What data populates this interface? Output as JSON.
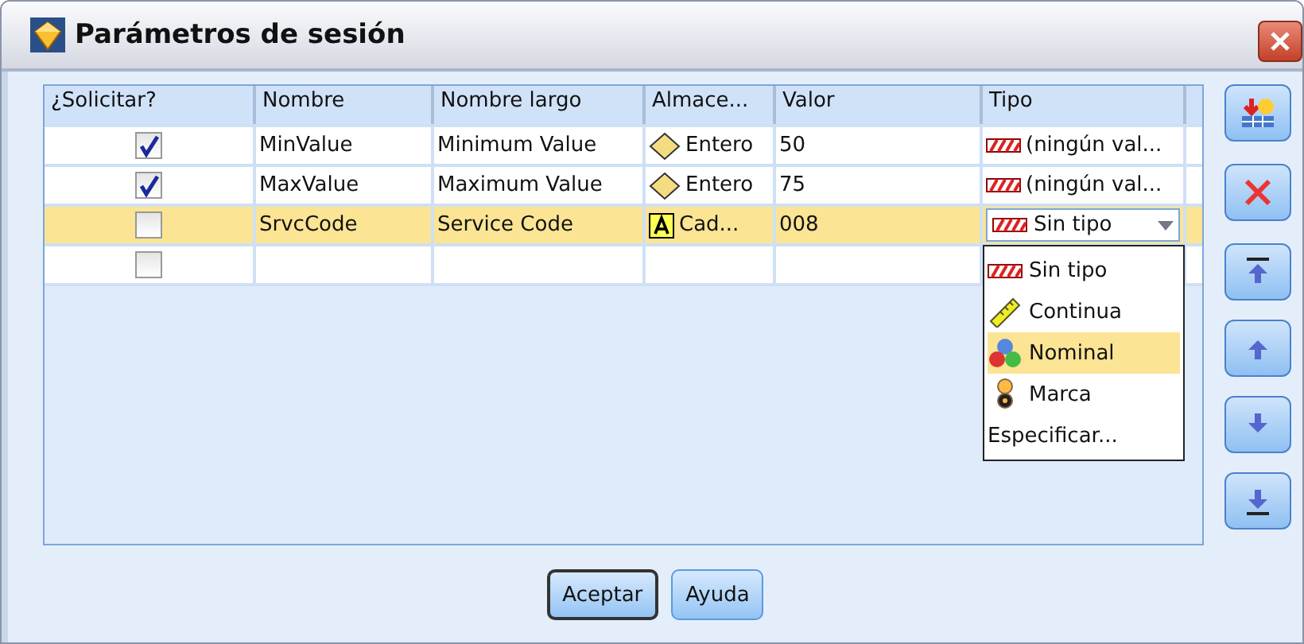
{
  "window": {
    "title": "Parámetros de sesión"
  },
  "table": {
    "columns": [
      "¿Solicitar?",
      "Nombre",
      "Nombre largo",
      "Almace...",
      "Valor",
      "Tipo"
    ],
    "rows": [
      {
        "selected": false,
        "prompt": true,
        "name": "MinValue",
        "long_name": "Minimum Value",
        "storage": {
          "kind": "integer",
          "label": "Entero"
        },
        "value": "50",
        "type": {
          "kind": "none",
          "label": "(ningún val..."
        }
      },
      {
        "selected": false,
        "prompt": true,
        "name": "MaxValue",
        "long_name": "Maximum Value",
        "storage": {
          "kind": "integer",
          "label": "Entero"
        },
        "value": "75",
        "type": {
          "kind": "none",
          "label": "(ningún val..."
        }
      },
      {
        "selected": true,
        "prompt": false,
        "name": "SrvcCode",
        "long_name": "Service Code",
        "storage": {
          "kind": "string",
          "label": "Cad..."
        },
        "value": "008",
        "type": {
          "kind": "none",
          "label": "Sin tipo",
          "editing": true
        }
      },
      {
        "selected": false,
        "prompt": false
      }
    ]
  },
  "dropdown": {
    "items": [
      {
        "kind": "none",
        "label": "Sin tipo",
        "selected": false
      },
      {
        "kind": "continuous",
        "label": "Continua",
        "selected": false
      },
      {
        "kind": "nominal",
        "label": "Nominal",
        "selected": true
      },
      {
        "kind": "flag",
        "label": "Marca",
        "selected": false
      },
      {
        "kind": "text",
        "label": "Especificar...",
        "selected": false
      }
    ]
  },
  "side_buttons": [
    {
      "kind": "add"
    },
    {
      "kind": "delete"
    },
    {
      "kind": "top"
    },
    {
      "kind": "up"
    },
    {
      "kind": "down"
    },
    {
      "kind": "bottom"
    }
  ],
  "buttons": [
    {
      "label": "Aceptar",
      "default": true
    },
    {
      "label": "Ayuda",
      "default": false
    }
  ]
}
